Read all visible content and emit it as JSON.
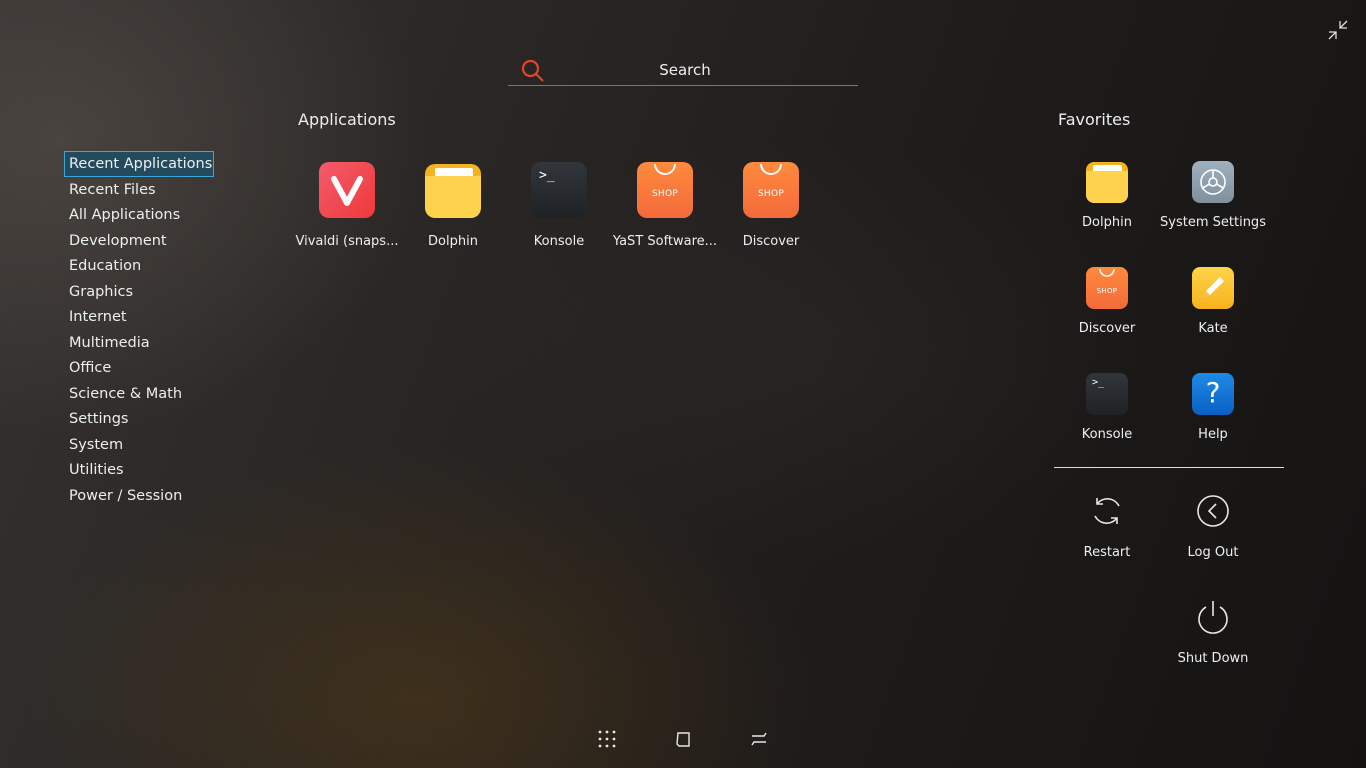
{
  "search": {
    "placeholder": "Search"
  },
  "applications": {
    "heading": "Applications",
    "items": [
      {
        "label": "Vivaldi (snaps...",
        "icon": "vivaldi-icon"
      },
      {
        "label": "Dolphin",
        "icon": "folder-icon"
      },
      {
        "label": "Konsole",
        "icon": "terminal-icon"
      },
      {
        "label": "YaST Software...",
        "icon": "shop-bag-icon"
      },
      {
        "label": "Discover",
        "icon": "shop-bag-icon"
      }
    ]
  },
  "categories": {
    "selected": "Recent Applications",
    "items": [
      "Recent Applications",
      "Recent Files",
      "All Applications",
      "Development",
      "Education",
      "Graphics",
      "Internet",
      "Multimedia",
      "Office",
      "Science & Math",
      "Settings",
      "System",
      "Utilities",
      "Power / Session"
    ]
  },
  "favorites": {
    "heading": "Favorites",
    "items": [
      {
        "label": "Dolphin",
        "icon": "folder-icon"
      },
      {
        "label": "System Settings",
        "icon": "gear-icon"
      },
      {
        "label": "Discover",
        "icon": "shop-bag-icon"
      },
      {
        "label": "Kate",
        "icon": "pencil-icon"
      },
      {
        "label": "Konsole",
        "icon": "terminal-icon"
      },
      {
        "label": "Help",
        "icon": "question-icon"
      }
    ]
  },
  "power": {
    "restart": "Restart",
    "logout": "Log Out",
    "shutdown": "Shut Down"
  },
  "icon_text": {
    "shop": "SHOP",
    "term": ">_",
    "help": "?"
  },
  "colors": {
    "accent": "#d9532c",
    "selection": "#3aa7d8",
    "text": "#eceff1"
  }
}
